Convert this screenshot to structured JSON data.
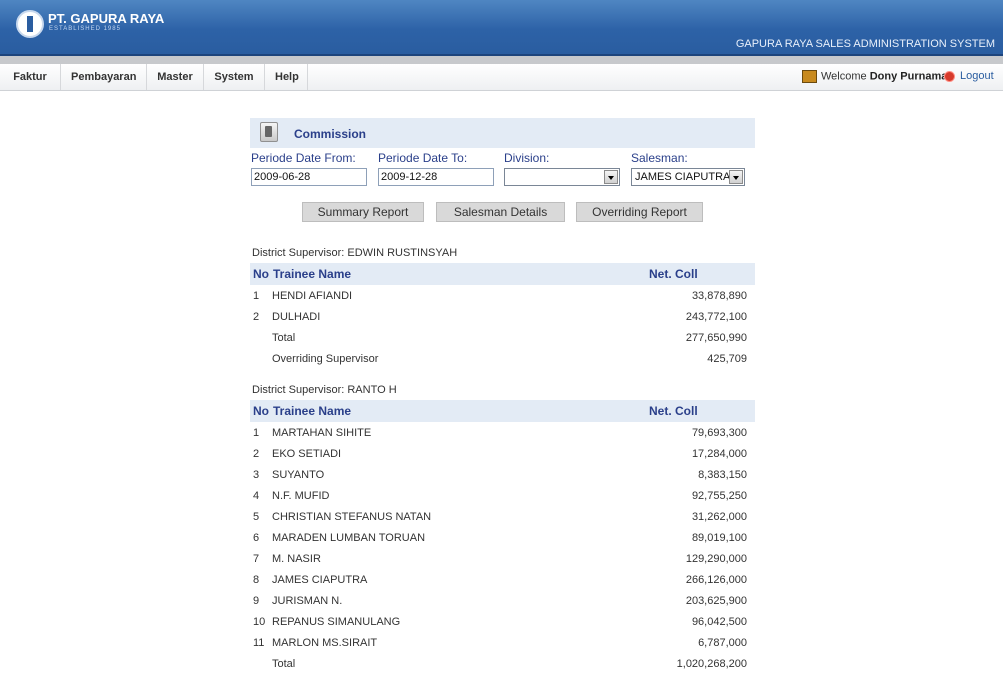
{
  "header": {
    "brand": "PT. GAPURA RAYA",
    "brand_sub": "ESTABLISHED 1985",
    "system_title": "GAPURA RAYA SALES ADMINISTRATION SYSTEM"
  },
  "menu": [
    "Faktur",
    "Pembayaran",
    "Master",
    "System",
    "Help"
  ],
  "user": {
    "welcome_prefix": "Welcome",
    "name": "Dony Purnama",
    "logout": "Logout"
  },
  "panel": {
    "title": "Commission",
    "filters": {
      "from_label": "Periode Date From:",
      "from_value": "2009-06-28",
      "to_label": "Periode Date To:",
      "to_value": "2009-12-28",
      "division_label": "Division:",
      "division_value": "",
      "salesman_label": "Salesman:",
      "salesman_value": "JAMES CIAPUTRA"
    },
    "buttons": {
      "summary": "Summary Report",
      "details": "Salesman Details",
      "overriding": "Overriding Report"
    }
  },
  "table_header": {
    "no": "No",
    "name": "Trainee Name",
    "coll": "Net. Coll"
  },
  "groups": [
    {
      "district": "District Supervisor: EDWIN RUSTINSYAH",
      "rows": [
        {
          "no": "1",
          "name": "HENDI AFIANDI",
          "coll": "33,878,890"
        },
        {
          "no": "2",
          "name": "DULHADI",
          "coll": "243,772,100"
        },
        {
          "no": "",
          "name": "Total",
          "coll": "277,650,990"
        },
        {
          "no": "",
          "name": "Overriding Supervisor",
          "coll": "425,709"
        }
      ]
    },
    {
      "district": "District Supervisor: RANTO H",
      "rows": [
        {
          "no": "1",
          "name": "MARTAHAN SIHITE",
          "coll": "79,693,300"
        },
        {
          "no": "2",
          "name": "EKO SETIADI",
          "coll": "17,284,000"
        },
        {
          "no": "3",
          "name": "SUYANTO",
          "coll": "8,383,150"
        },
        {
          "no": "4",
          "name": "N.F. MUFID",
          "coll": "92,755,250"
        },
        {
          "no": "5",
          "name": "CHRISTIAN STEFANUS NATAN",
          "coll": "31,262,000"
        },
        {
          "no": "6",
          "name": "MARADEN LUMBAN TORUAN",
          "coll": "89,019,100"
        },
        {
          "no": "7",
          "name": "M. NASIR",
          "coll": "129,290,000"
        },
        {
          "no": "8",
          "name": "JAMES CIAPUTRA",
          "coll": "266,126,000"
        },
        {
          "no": "9",
          "name": "JURISMAN N.",
          "coll": "203,625,900"
        },
        {
          "no": "10",
          "name": "REPANUS SIMANULANG",
          "coll": "96,042,500"
        },
        {
          "no": "11",
          "name": "MARLON MS.SIRAIT",
          "coll": "6,787,000"
        },
        {
          "no": "",
          "name": "Total",
          "coll": "1,020,268,200"
        }
      ]
    }
  ]
}
